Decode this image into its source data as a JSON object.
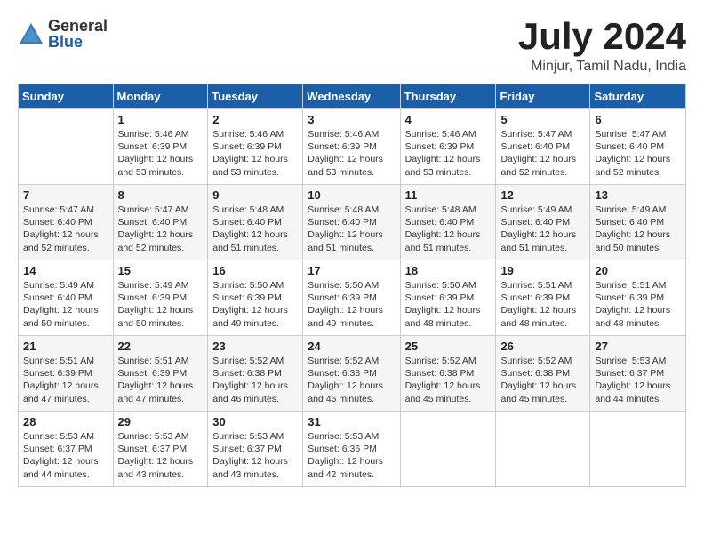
{
  "header": {
    "logo_general": "General",
    "logo_blue": "Blue",
    "month_title": "July 2024",
    "location": "Minjur, Tamil Nadu, India"
  },
  "calendar": {
    "days_of_week": [
      "Sunday",
      "Monday",
      "Tuesday",
      "Wednesday",
      "Thursday",
      "Friday",
      "Saturday"
    ],
    "weeks": [
      [
        {
          "day": "",
          "info": ""
        },
        {
          "day": "1",
          "info": "Sunrise: 5:46 AM\nSunset: 6:39 PM\nDaylight: 12 hours\nand 53 minutes."
        },
        {
          "day": "2",
          "info": "Sunrise: 5:46 AM\nSunset: 6:39 PM\nDaylight: 12 hours\nand 53 minutes."
        },
        {
          "day": "3",
          "info": "Sunrise: 5:46 AM\nSunset: 6:39 PM\nDaylight: 12 hours\nand 53 minutes."
        },
        {
          "day": "4",
          "info": "Sunrise: 5:46 AM\nSunset: 6:39 PM\nDaylight: 12 hours\nand 53 minutes."
        },
        {
          "day": "5",
          "info": "Sunrise: 5:47 AM\nSunset: 6:40 PM\nDaylight: 12 hours\nand 52 minutes."
        },
        {
          "day": "6",
          "info": "Sunrise: 5:47 AM\nSunset: 6:40 PM\nDaylight: 12 hours\nand 52 minutes."
        }
      ],
      [
        {
          "day": "7",
          "info": "Sunrise: 5:47 AM\nSunset: 6:40 PM\nDaylight: 12 hours\nand 52 minutes."
        },
        {
          "day": "8",
          "info": "Sunrise: 5:47 AM\nSunset: 6:40 PM\nDaylight: 12 hours\nand 52 minutes."
        },
        {
          "day": "9",
          "info": "Sunrise: 5:48 AM\nSunset: 6:40 PM\nDaylight: 12 hours\nand 51 minutes."
        },
        {
          "day": "10",
          "info": "Sunrise: 5:48 AM\nSunset: 6:40 PM\nDaylight: 12 hours\nand 51 minutes."
        },
        {
          "day": "11",
          "info": "Sunrise: 5:48 AM\nSunset: 6:40 PM\nDaylight: 12 hours\nand 51 minutes."
        },
        {
          "day": "12",
          "info": "Sunrise: 5:49 AM\nSunset: 6:40 PM\nDaylight: 12 hours\nand 51 minutes."
        },
        {
          "day": "13",
          "info": "Sunrise: 5:49 AM\nSunset: 6:40 PM\nDaylight: 12 hours\nand 50 minutes."
        }
      ],
      [
        {
          "day": "14",
          "info": "Sunrise: 5:49 AM\nSunset: 6:40 PM\nDaylight: 12 hours\nand 50 minutes."
        },
        {
          "day": "15",
          "info": "Sunrise: 5:49 AM\nSunset: 6:39 PM\nDaylight: 12 hours\nand 50 minutes."
        },
        {
          "day": "16",
          "info": "Sunrise: 5:50 AM\nSunset: 6:39 PM\nDaylight: 12 hours\nand 49 minutes."
        },
        {
          "day": "17",
          "info": "Sunrise: 5:50 AM\nSunset: 6:39 PM\nDaylight: 12 hours\nand 49 minutes."
        },
        {
          "day": "18",
          "info": "Sunrise: 5:50 AM\nSunset: 6:39 PM\nDaylight: 12 hours\nand 48 minutes."
        },
        {
          "day": "19",
          "info": "Sunrise: 5:51 AM\nSunset: 6:39 PM\nDaylight: 12 hours\nand 48 minutes."
        },
        {
          "day": "20",
          "info": "Sunrise: 5:51 AM\nSunset: 6:39 PM\nDaylight: 12 hours\nand 48 minutes."
        }
      ],
      [
        {
          "day": "21",
          "info": "Sunrise: 5:51 AM\nSunset: 6:39 PM\nDaylight: 12 hours\nand 47 minutes."
        },
        {
          "day": "22",
          "info": "Sunrise: 5:51 AM\nSunset: 6:39 PM\nDaylight: 12 hours\nand 47 minutes."
        },
        {
          "day": "23",
          "info": "Sunrise: 5:52 AM\nSunset: 6:38 PM\nDaylight: 12 hours\nand 46 minutes."
        },
        {
          "day": "24",
          "info": "Sunrise: 5:52 AM\nSunset: 6:38 PM\nDaylight: 12 hours\nand 46 minutes."
        },
        {
          "day": "25",
          "info": "Sunrise: 5:52 AM\nSunset: 6:38 PM\nDaylight: 12 hours\nand 45 minutes."
        },
        {
          "day": "26",
          "info": "Sunrise: 5:52 AM\nSunset: 6:38 PM\nDaylight: 12 hours\nand 45 minutes."
        },
        {
          "day": "27",
          "info": "Sunrise: 5:53 AM\nSunset: 6:37 PM\nDaylight: 12 hours\nand 44 minutes."
        }
      ],
      [
        {
          "day": "28",
          "info": "Sunrise: 5:53 AM\nSunset: 6:37 PM\nDaylight: 12 hours\nand 44 minutes."
        },
        {
          "day": "29",
          "info": "Sunrise: 5:53 AM\nSunset: 6:37 PM\nDaylight: 12 hours\nand 43 minutes."
        },
        {
          "day": "30",
          "info": "Sunrise: 5:53 AM\nSunset: 6:37 PM\nDaylight: 12 hours\nand 43 minutes."
        },
        {
          "day": "31",
          "info": "Sunrise: 5:53 AM\nSunset: 6:36 PM\nDaylight: 12 hours\nand 42 minutes."
        },
        {
          "day": "",
          "info": ""
        },
        {
          "day": "",
          "info": ""
        },
        {
          "day": "",
          "info": ""
        }
      ]
    ]
  }
}
